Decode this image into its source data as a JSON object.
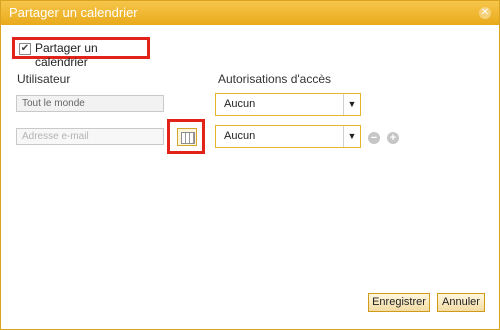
{
  "dialog": {
    "title": "Partager un calendrier",
    "close_icon": "close-icon"
  },
  "share_checkbox": {
    "label": "Partager un calendrier",
    "checked": true
  },
  "columns": {
    "user": "Utilisateur",
    "permissions": "Autorisations d'accès"
  },
  "rows": [
    {
      "user_value": "Tout le monde",
      "permission": "Aucun"
    },
    {
      "user_placeholder": "Adresse e-mail",
      "permission": "Aucun"
    }
  ],
  "icons": {
    "address_book": "address-book-icon",
    "remove": "remove-row-icon",
    "add": "add-row-icon",
    "dropdown": "chevron-down-icon"
  },
  "buttons": {
    "save": "Enregistrer",
    "cancel": "Annuler"
  },
  "colors": {
    "title_bar": "#eab027",
    "highlight": "#e2231a",
    "select_border": "#e6b52a"
  }
}
